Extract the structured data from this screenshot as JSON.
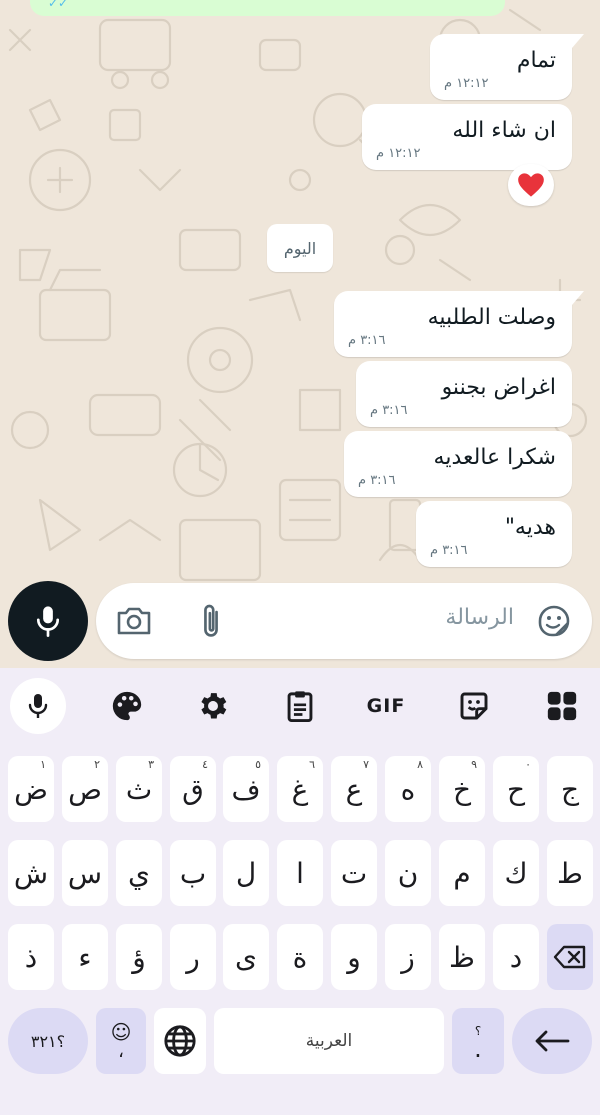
{
  "colors": {
    "chat_bg": "#efe6da",
    "bubble_out": "#ffffff",
    "top_bubble": "#d9fdd3",
    "keyboard_bg": "#f1edf7",
    "special_key": "#dcdaf4",
    "heart": "#e8333b"
  },
  "messages": [
    {
      "text": "تمام",
      "time": "١٢:١٢ م"
    },
    {
      "text": "ان شاء الله",
      "time": "١٢:١٢ م"
    },
    {
      "text": "وصلت الطلبيه",
      "time": "٣:١٦ م"
    },
    {
      "text": "اغراض بجننو",
      "time": "٣:١٦ م"
    },
    {
      "text": "شكرا عالعديه",
      "time": "٣:١٦ م"
    },
    {
      "text": "هديه\"",
      "time": "٣:١٦ م"
    }
  ],
  "top_partial_time": "م",
  "reaction": {
    "icon": "heart-icon"
  },
  "date_divider": "اليوم",
  "composer": {
    "placeholder": "الرسالة",
    "icons": [
      "camera-icon",
      "attach-icon",
      "sticker-icon",
      "mic-icon"
    ]
  },
  "keyboard": {
    "toolbar": [
      "mic-icon",
      "palette-icon",
      "settings-icon",
      "clipboard-icon",
      "GIF",
      "sticker-icon",
      "grid-icon"
    ],
    "row1": [
      {
        "c": "ض",
        "h": "١"
      },
      {
        "c": "ص",
        "h": "٢"
      },
      {
        "c": "ث",
        "h": "٣"
      },
      {
        "c": "ق",
        "h": "٤"
      },
      {
        "c": "ف",
        "h": "٥"
      },
      {
        "c": "غ",
        "h": "٦"
      },
      {
        "c": "ع",
        "h": "٧"
      },
      {
        "c": "ه",
        "h": "٨"
      },
      {
        "c": "خ",
        "h": "٩"
      },
      {
        "c": "ح",
        "h": "٠"
      },
      {
        "c": "ج",
        "h": ""
      }
    ],
    "row2": [
      "ش",
      "س",
      "ي",
      "ب",
      "ل",
      "ا",
      "ت",
      "ن",
      "م",
      "ك",
      "ط"
    ],
    "row3": [
      "ذ",
      "ء",
      "ؤ",
      "ر",
      "ى",
      "ة",
      "و",
      "ز",
      "ظ",
      "د"
    ],
    "symbols_label": "؟٣٢١",
    "comma_label": "،",
    "space_label": "العربية",
    "period_label": ".",
    "period_hint": "؟"
  }
}
